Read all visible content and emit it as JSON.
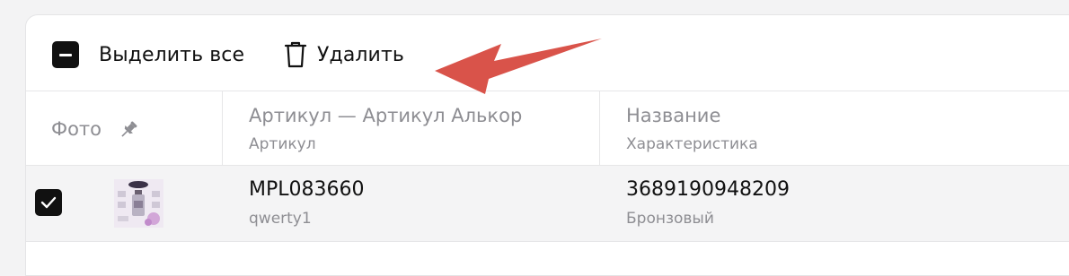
{
  "toolbar": {
    "select_all_label": "Выделить все",
    "delete_label": "Удалить"
  },
  "annotation": {
    "arrow_color": "#d9534a"
  },
  "table": {
    "columns": [
      {
        "title": "Фото",
        "subtitle": ""
      },
      {
        "title": "Артикул — Артикул Алькор",
        "subtitle": "Артикул"
      },
      {
        "title": "Название",
        "subtitle": "Характеристика"
      }
    ],
    "rows": [
      {
        "selected": true,
        "sku": "MPL083660",
        "sku_alt": "qwerty1",
        "name": "3689190948209",
        "characteristic": "Бронзовый"
      }
    ]
  },
  "icons": [
    "minus-checkbox-icon",
    "trash-icon",
    "pin-icon",
    "checkmark-icon"
  ]
}
